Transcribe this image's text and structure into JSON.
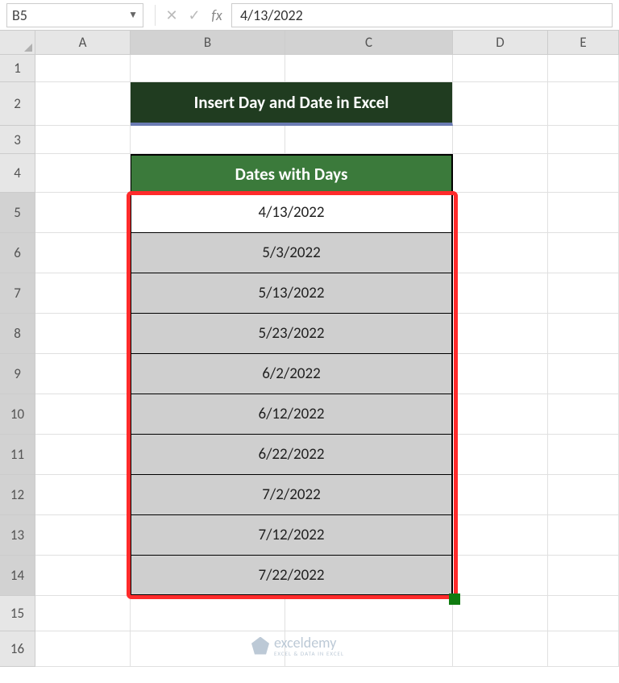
{
  "name_box": "B5",
  "formula_value": "4/13/2022",
  "columns": [
    "A",
    "B",
    "C",
    "D",
    "E"
  ],
  "row_numbers": [
    "1",
    "2",
    "3",
    "4",
    "5",
    "6",
    "7",
    "8",
    "9",
    "10",
    "11",
    "12",
    "13",
    "14",
    "15",
    "16"
  ],
  "title": "Insert Day and Date in Excel",
  "table_header": "Dates with Days",
  "dates": [
    "4/13/2022",
    "5/3/2022",
    "5/13/2022",
    "5/23/2022",
    "6/2/2022",
    "6/12/2022",
    "6/22/2022",
    "7/2/2022",
    "7/12/2022",
    "7/22/2022"
  ],
  "watermark": {
    "name": "exceldemy",
    "sub": "EXCEL & DATA IN EXCEL"
  }
}
